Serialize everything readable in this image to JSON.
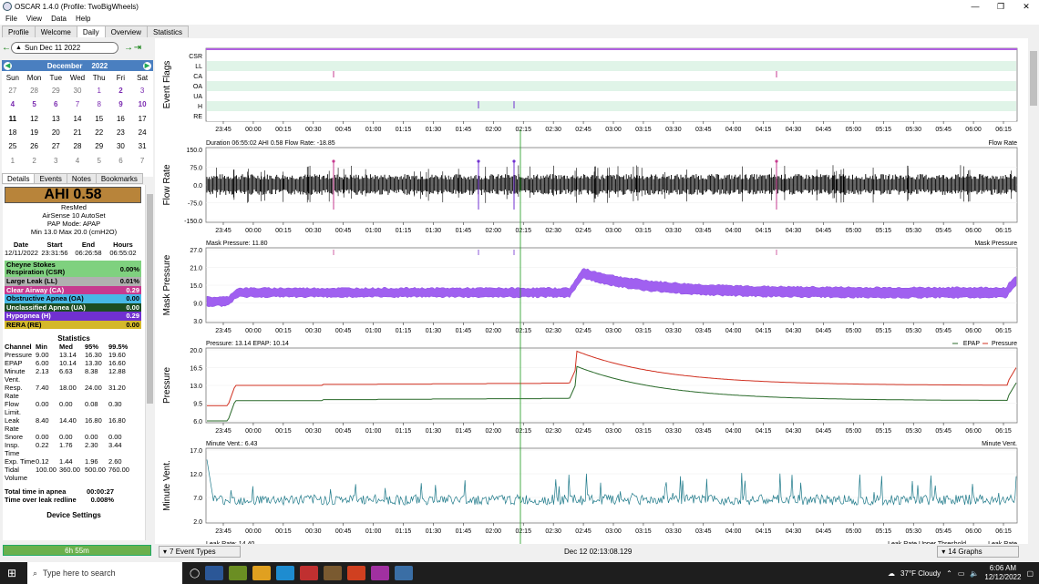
{
  "window": {
    "title": "OSCAR 1.4.0 (Profile: TwoBigWheels)"
  },
  "menu": [
    "File",
    "View",
    "Data",
    "Help"
  ],
  "tabs": [
    {
      "label": "Profile"
    },
    {
      "label": "Welcome"
    },
    {
      "label": "Daily",
      "active": true
    },
    {
      "label": "Overview"
    },
    {
      "label": "Statistics"
    }
  ],
  "datenav": {
    "date": "Sun Dec 11 2022"
  },
  "calendar": {
    "month": "December",
    "year": "2022",
    "dow": [
      "Sun",
      "Mon",
      "Tue",
      "Wed",
      "Thu",
      "Fri",
      "Sat"
    ],
    "weeks": [
      [
        "27",
        "28",
        "29",
        "30",
        "1",
        "2",
        "3"
      ],
      [
        "4",
        "5",
        "6",
        "7",
        "8",
        "9",
        "10"
      ],
      [
        "11",
        "12",
        "13",
        "14",
        "15",
        "16",
        "17"
      ],
      [
        "18",
        "19",
        "20",
        "21",
        "22",
        "23",
        "24"
      ],
      [
        "25",
        "26",
        "27",
        "28",
        "29",
        "30",
        "31"
      ],
      [
        "1",
        "2",
        "3",
        "4",
        "5",
        "6",
        "7"
      ]
    ]
  },
  "subtabs": [
    "Details",
    "Events",
    "Notes",
    "Bookmarks"
  ],
  "details": {
    "ahi": "AHI 0.58",
    "brand": "ResMed",
    "model": "AirSense 10 AutoSet",
    "mode": "PAP Mode: APAP",
    "pressure": "Min 13.0 Max 20.0 (cmH2O)",
    "session_head": [
      "Date",
      "Start",
      "End",
      "Hours"
    ],
    "session_vals": [
      "12/11/2022",
      "23:31:56",
      "06:26:58",
      "06:55:02"
    ],
    "events": [
      {
        "name": "Cheyne Stokes Respiration (CSR)",
        "val": "0.00%",
        "color": "#7fd17f",
        "fg": "#000"
      },
      {
        "name": "Large Leak (LL)",
        "val": "0.01%",
        "color": "#b0b0b0",
        "fg": "#000"
      },
      {
        "name": "Clear Airway (CA)",
        "val": "0.29",
        "color": "#c63a8f",
        "fg": "#fff"
      },
      {
        "name": "Obstructive Apnea (OA)",
        "val": "0.00",
        "color": "#47b8e6",
        "fg": "#000"
      },
      {
        "name": "Unclassified Apnea (UA)",
        "val": "0.00",
        "color": "#1c4d22",
        "fg": "#fff"
      },
      {
        "name": "Hypopnea (H)",
        "val": "0.29",
        "color": "#7030d0",
        "fg": "#fff"
      },
      {
        "name": "RERA (RE)",
        "val": "0.00",
        "color": "#d4b82a",
        "fg": "#000"
      }
    ],
    "stats_title": "Statistics",
    "stats_head": [
      "Channel",
      "Min",
      "Med",
      "95%",
      "99.5%"
    ],
    "stats": [
      [
        "Pressure",
        "9.00",
        "13.14",
        "16.30",
        "19.60"
      ],
      [
        "EPAP",
        "6.00",
        "10.14",
        "13.30",
        "16.60"
      ],
      [
        "Minute Vent.",
        "2.13",
        "6.63",
        "8.38",
        "12.88"
      ],
      [
        "Resp. Rate",
        "7.40",
        "18.00",
        "24.00",
        "31.20"
      ],
      [
        "Flow Limit.",
        "0.00",
        "0.00",
        "0.08",
        "0.30"
      ],
      [
        "Leak Rate",
        "8.40",
        "14.40",
        "16.80",
        "16.80"
      ],
      [
        "Snore",
        "0.00",
        "0.00",
        "0.00",
        "0.00"
      ],
      [
        "Insp. Time",
        "0.22",
        "1.76",
        "2.30",
        "3.44"
      ],
      [
        "Exp. Time",
        "0.12",
        "1.44",
        "1.96",
        "2.60"
      ],
      [
        "Tidal Volume",
        "100.00",
        "360.00",
        "500.00",
        "760.00"
      ]
    ],
    "apnea_label": "Total time in apnea",
    "apnea_val": "00:00:27",
    "leak_label": "Time over leak redline",
    "leak_val": "0.008%",
    "device_settings": "Device Settings"
  },
  "usage": "6h 55m",
  "graphs": {
    "time_ticks": [
      "23:45",
      "00:00",
      "00:15",
      "00:30",
      "00:45",
      "01:00",
      "01:15",
      "01:30",
      "01:45",
      "02:00",
      "02:15",
      "02:30",
      "02:45",
      "03:00",
      "03:15",
      "03:30",
      "03:45",
      "04:00",
      "04:15",
      "04:30",
      "04:45",
      "05:00",
      "05:15",
      "05:30",
      "05:45",
      "06:00",
      "06:15"
    ],
    "event_flags": {
      "ylabel": "Event Flags",
      "rows": [
        "CSR",
        "LL",
        "CA",
        "OA",
        "UA",
        "H",
        "RE"
      ]
    },
    "flow": {
      "ylabel": "Flow Rate",
      "header": "Duration 06:55:02 AHI 0.58 Flow Rate: -18.85",
      "legend": "Flow Rate",
      "yticks": [
        "150.0",
        "75.0",
        "0.0",
        "-75.0",
        "-150.0"
      ]
    },
    "mask": {
      "ylabel": "Mask Pressure",
      "header": "Mask Pressure: 11.80",
      "legend": "Mask Pressure",
      "yticks": [
        "27.0",
        "21.0",
        "15.0",
        "9.0",
        "3.0"
      ]
    },
    "pressure": {
      "ylabel": "Pressure",
      "header": "Pressure: 13.14 EPAP: 10.14",
      "legend_epap": "EPAP",
      "legend_pressure": "Pressure",
      "yticks": [
        "20.0",
        "16.5",
        "13.0",
        "9.5",
        "6.0"
      ]
    },
    "minvent": {
      "ylabel": "Minute Vent.",
      "header": "Minute Vent.: 6.43",
      "legend": "Minute Vent.",
      "yticks": [
        "17.0",
        "12.0",
        "7.0",
        "2.0"
      ]
    },
    "leak": {
      "header": "Leak Rate: 14.40",
      "legend": "Leak Rate Upper Threshold",
      "legend2": "Leak Rate"
    }
  },
  "bottom": {
    "event_types": "7 Event Types",
    "timestamp": "Dec 12 02:13:08.129",
    "graphs": "14 Graphs"
  },
  "taskbar": {
    "search": "Type here to search",
    "weather": "37°F Cloudy",
    "time": "6:06 AM",
    "date": "12/12/2022"
  }
}
